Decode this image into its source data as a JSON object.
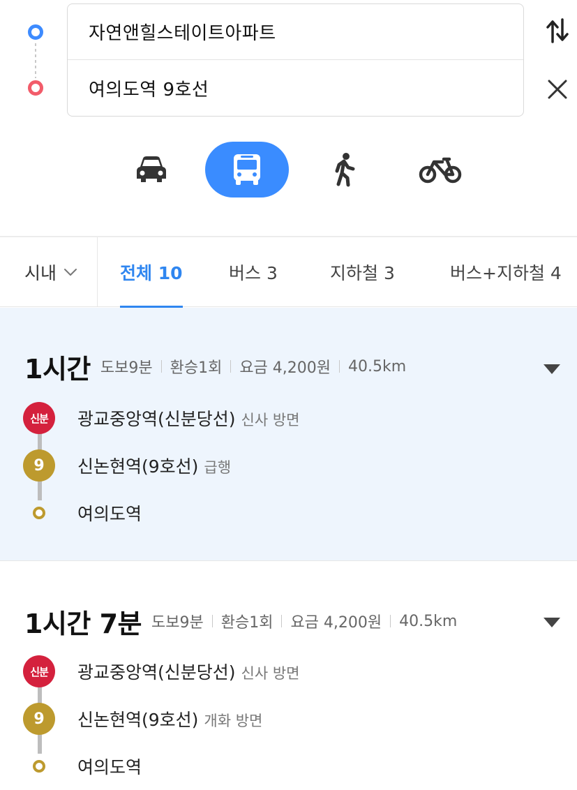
{
  "search": {
    "origin": "자연앤힐스테이트아파트",
    "destination": "여의도역 9호선"
  },
  "modes": {
    "items": [
      "car",
      "bus",
      "walk",
      "bike"
    ],
    "selected": "bus"
  },
  "filters": {
    "city": "시내",
    "tabs": [
      {
        "label": "전체 10",
        "active": true
      },
      {
        "label": "버스 3",
        "active": false
      },
      {
        "label": "지하철 3",
        "active": false
      },
      {
        "label": "버스+지하철 4",
        "active": false
      }
    ]
  },
  "routes": [
    {
      "duration": "1시간",
      "walk": "도보9분",
      "transfer": "환승1회",
      "fare": "요금 4,200원",
      "distance": "40.5km",
      "selected": true,
      "steps": [
        {
          "badge": "신분",
          "station": "광교중앙역(신분당선)",
          "note": "신사 방면"
        },
        {
          "badge": "9",
          "station": "신논현역(9호선)",
          "note": "급행"
        },
        {
          "badge": "",
          "station": "여의도역",
          "note": ""
        }
      ]
    },
    {
      "duration": "1시간 7분",
      "walk": "도보9분",
      "transfer": "환승1회",
      "fare": "요금 4,200원",
      "distance": "40.5km",
      "selected": false,
      "steps": [
        {
          "badge": "신분",
          "station": "광교중앙역(신분당선)",
          "note": "신사 방면"
        },
        {
          "badge": "9",
          "station": "신논현역(9호선)",
          "note": "개화 방면"
        },
        {
          "badge": "",
          "station": "여의도역",
          "note": ""
        }
      ]
    }
  ],
  "colors": {
    "accent": "#3a8cff",
    "tab_active": "#2f86f0",
    "origin_dot": "#3d8bff",
    "destination_dot": "#f25c6a",
    "sinbundang_line": "#d4213d",
    "line9": "#bd9a2e",
    "selected_route_bg": "#eef5fd"
  },
  "icons": {
    "swap": "swap-arrows-icon",
    "close": "close-icon",
    "car": "car-icon",
    "bus": "bus-icon",
    "walk": "walk-icon",
    "bike": "bike-icon",
    "chevron": "chevron-down-icon",
    "expand": "caret-down-icon"
  }
}
